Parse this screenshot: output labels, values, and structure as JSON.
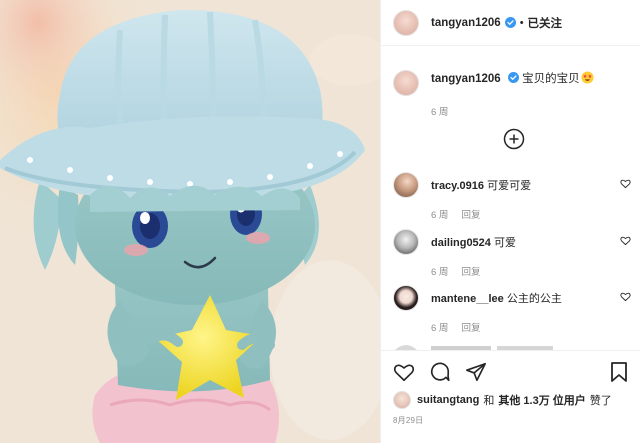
{
  "post": {
    "username": "tangyan1206",
    "follow_state": "已关注",
    "separator": "•",
    "caption": {
      "username": "tangyan1206",
      "text": "宝贝的宝贝",
      "emoji": "star-struck-emoji",
      "time": "6 周"
    },
    "load_more_icon": "plus-circle-icon"
  },
  "comments": [
    {
      "username": "tracy.0916",
      "text": "可爱可爱",
      "time": "6 周",
      "reply": "回复"
    },
    {
      "username": "dailing0524",
      "text": "可爱",
      "time": "6 周",
      "reply": "回复"
    },
    {
      "username": "mantene__lee",
      "text": "公主的公主",
      "time": "6 周",
      "reply": "回复"
    }
  ],
  "actions": {
    "icons": [
      "heart-icon",
      "comment-icon",
      "share-icon",
      "bookmark-icon"
    ]
  },
  "likes": {
    "user": "suitangtang",
    "and": "和",
    "others": "其他 1.3万 位用户",
    "liked": "赞了"
  },
  "date": "8月29日",
  "colors": {
    "verified": "#3897f0",
    "text": "#262626",
    "muted": "#8e8e8e",
    "border": "#efefef"
  }
}
